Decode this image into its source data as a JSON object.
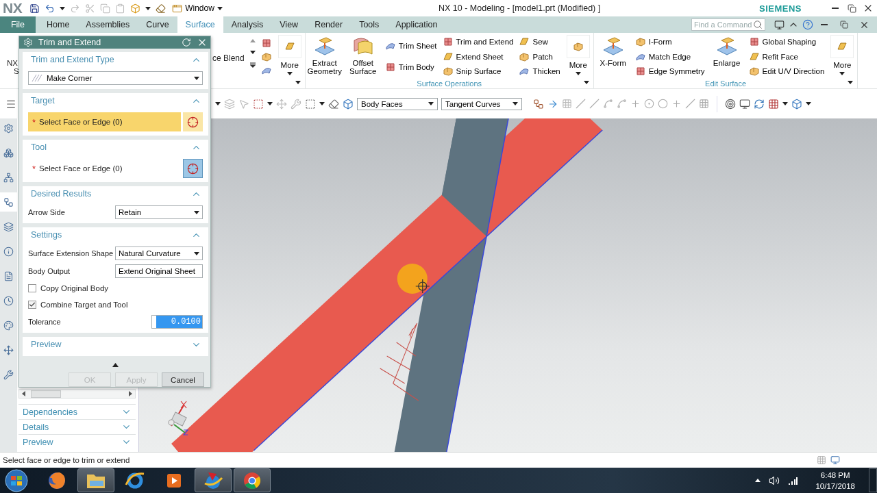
{
  "title_bar": {
    "logo": "NX",
    "window_menu": "Window",
    "title": "NX 10 - Modeling - [model1.prt (Modified) ]",
    "brand": "SIEMENS"
  },
  "tabs": [
    {
      "label": "File",
      "kind": "file",
      "selected": false
    },
    {
      "label": "Home",
      "kind": "tab",
      "selected": false
    },
    {
      "label": "Assemblies",
      "kind": "tab",
      "selected": false
    },
    {
      "label": "Curve",
      "kind": "tab",
      "selected": false
    },
    {
      "label": "Surface",
      "kind": "tab",
      "selected": true
    },
    {
      "label": "Analysis",
      "kind": "tab",
      "selected": false
    },
    {
      "label": "View",
      "kind": "tab",
      "selected": false
    },
    {
      "label": "Render",
      "kind": "tab",
      "selected": false
    },
    {
      "label": "Tools",
      "kind": "tab",
      "selected": false
    },
    {
      "label": "Application",
      "kind": "tab",
      "selected": false
    }
  ],
  "command_search": {
    "placeholder": "Find a Command"
  },
  "ribbon": {
    "cut_item": [
      "NX",
      "S"
    ],
    "cut_blend": "ce Blend",
    "first_more": "More",
    "groups": [
      {
        "label": "Surface Operations",
        "items": [
          {
            "kind": "large",
            "label": "Extract Geometry"
          },
          {
            "kind": "large",
            "label": "Offset Surface"
          },
          {
            "kind": "column",
            "items": [
              "Trim Sheet",
              "Trim Body"
            ]
          },
          {
            "kind": "column",
            "items": [
              "Trim and Extend",
              "Extend Sheet",
              "Snip Surface"
            ]
          },
          {
            "kind": "column",
            "items": [
              "Sew",
              "Patch",
              "Thicken"
            ]
          },
          {
            "kind": "more",
            "label": "More"
          }
        ]
      },
      {
        "label": "Edit Surface",
        "items": [
          {
            "kind": "large",
            "label": "X-Form"
          },
          {
            "kind": "column",
            "items": [
              "I-Form",
              "Match Edge",
              "Edge Symmetry"
            ]
          },
          {
            "kind": "large",
            "label": "Enlarge"
          },
          {
            "kind": "column",
            "items": [
              "Global Shaping",
              "Refit Face",
              "Edit U/V Direction"
            ]
          },
          {
            "kind": "more",
            "label": "More"
          }
        ]
      }
    ]
  },
  "selection_bar": {
    "filters": [
      {
        "value": "Body Faces"
      },
      {
        "value": "Tangent Curves"
      }
    ]
  },
  "resource_bar": {
    "tabs": [
      {
        "selected": false
      },
      {
        "selected": false
      },
      {
        "selected": false
      },
      {
        "selected": true
      },
      {
        "selected": false
      },
      {
        "selected": false
      },
      {
        "selected": false
      },
      {
        "selected": false
      },
      {
        "selected": false
      },
      {
        "selected": false
      },
      {
        "selected": false
      }
    ]
  },
  "navigator": {
    "panels": [
      {
        "label": "Dependencies",
        "expanded": false
      },
      {
        "label": "Details",
        "expanded": false
      },
      {
        "label": "Preview",
        "expanded": false
      }
    ]
  },
  "dialog": {
    "title": "Trim and Extend",
    "sections": [
      {
        "kind": "type",
        "title": "Trim and Extend Type",
        "expanded": true,
        "value": "Make Corner"
      },
      {
        "kind": "select",
        "title": "Target",
        "expanded": true,
        "selector": {
          "marker": "*",
          "label": "Select Face or Edge (0)",
          "selected": true,
          "active": false
        }
      },
      {
        "kind": "select",
        "title": "Tool",
        "expanded": true,
        "selector": {
          "marker": "*",
          "label": "Select Face or Edge (0)",
          "selected": false,
          "active": true
        }
      },
      {
        "kind": "fields",
        "title": "Desired Results",
        "expanded": true,
        "rows": [
          {
            "kind": "dropdown",
            "label": "Arrow Side",
            "value": "Retain"
          }
        ]
      },
      {
        "kind": "fields",
        "title": "Settings",
        "expanded": true,
        "rows": [
          {
            "kind": "dropdown",
            "label": "Surface Extension Shape",
            "value": "Natural Curvature"
          },
          {
            "kind": "dropdown",
            "label": "Body Output",
            "value": "Extend Original Sheet"
          },
          {
            "kind": "checkbox",
            "label": "Copy Original Body",
            "checked": false
          },
          {
            "kind": "checkbox",
            "label": "Combine Target and Tool",
            "checked": true
          },
          {
            "kind": "number",
            "label": "Tolerance",
            "value": "0.0100",
            "highlighted": true
          }
        ]
      },
      {
        "kind": "fields",
        "title": "Preview",
        "expanded": false
      }
    ],
    "buttons": [
      {
        "label": "OK",
        "disabled": true
      },
      {
        "label": "Apply",
        "disabled": true
      },
      {
        "label": "Cancel",
        "disabled": false
      }
    ]
  },
  "status_bar": {
    "message": "Select face or edge to trim or extend"
  },
  "taskbar": {
    "apps": [
      {
        "kind": "fox",
        "open": false
      },
      {
        "kind": "folder",
        "open": true
      },
      {
        "kind": "ring",
        "open": false
      },
      {
        "kind": "player",
        "open": false
      },
      {
        "kind": "cad",
        "open": true
      },
      {
        "kind": "ball",
        "open": true
      }
    ],
    "time": "6:48 PM",
    "date": "10/17/2018"
  }
}
